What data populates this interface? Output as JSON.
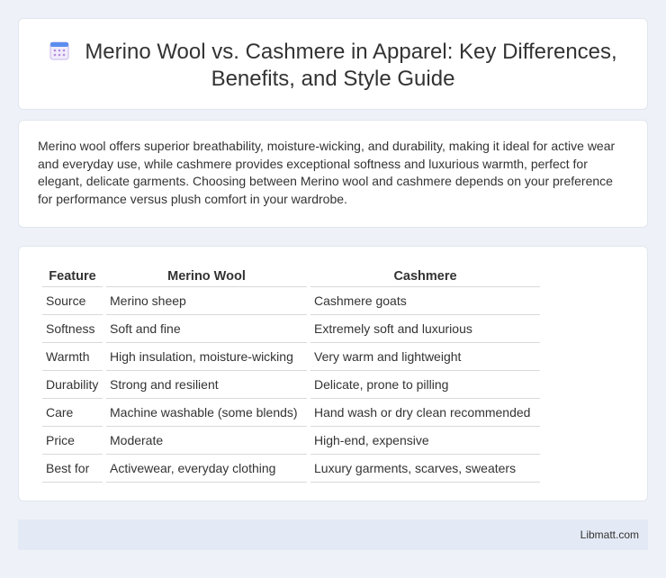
{
  "header": {
    "icon": "calendar-icon",
    "title": "Merino Wool vs. Cashmere in Apparel: Key Differences, Benefits, and Style Guide"
  },
  "summary": {
    "text": "Merino wool offers superior breathability, moisture-wicking, and durability, making it ideal for active wear and everyday use, while cashmere provides exceptional softness and luxurious warmth, perfect for elegant, delicate garments. Choosing between Merino wool and cashmere depends on your preference for performance versus plush comfort in your wardrobe."
  },
  "table": {
    "headers": [
      "Feature",
      "Merino Wool",
      "Cashmere"
    ],
    "rows": [
      [
        "Source",
        "Merino sheep",
        "Cashmere goats"
      ],
      [
        "Softness",
        "Soft and fine",
        "Extremely soft and luxurious"
      ],
      [
        "Warmth",
        "High insulation, moisture-wicking",
        "Very warm and lightweight"
      ],
      [
        "Durability",
        "Strong and resilient",
        "Delicate, prone to pilling"
      ],
      [
        "Care",
        "Machine washable (some blends)",
        "Hand wash or dry clean recommended"
      ],
      [
        "Price",
        "Moderate",
        "High-end, expensive"
      ],
      [
        "Best for",
        "Activewear, everyday clothing",
        "Luxury garments, scarves, sweaters"
      ]
    ]
  },
  "footer": {
    "text": "Libmatt.com"
  },
  "colors": {
    "background": "#eef2f8",
    "card": "#ffffff",
    "footer": "#e4eaf5",
    "icon_accent": "#5b8dee",
    "icon_grid": "#b48be0"
  }
}
